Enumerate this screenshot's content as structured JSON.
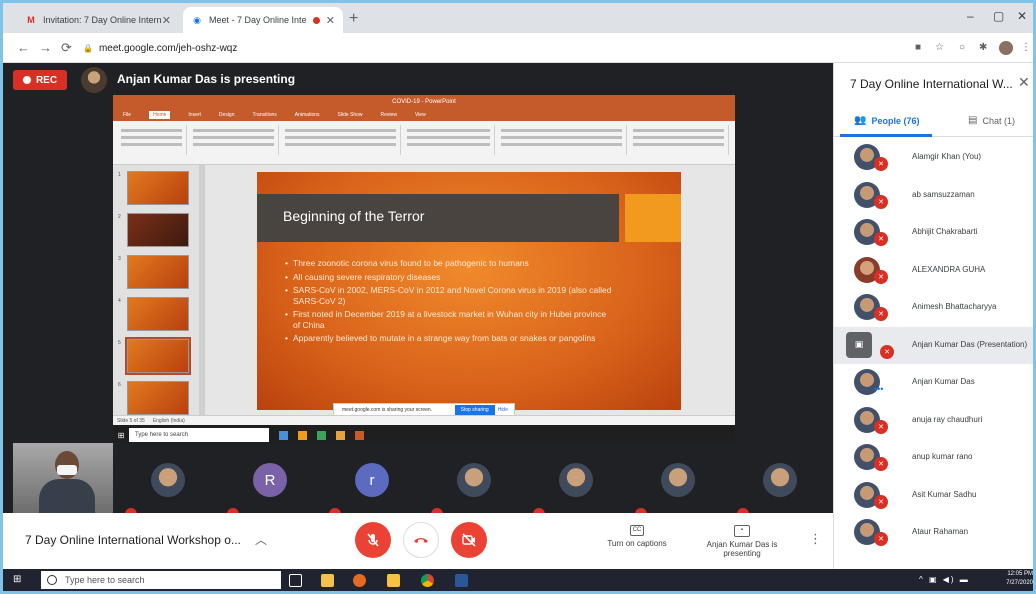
{
  "browser": {
    "tabs": [
      {
        "favicon": "M",
        "title": "Invitation: 7 Day Online Internati",
        "active": false
      },
      {
        "favicon": "◉",
        "title": "Meet - 7 Day Online Internat",
        "active": true
      }
    ],
    "url": "meet.google.com/jeh-oshz-wqz"
  },
  "meet": {
    "rec_label": "REC",
    "presenting_label": "Anjan Kumar Das is presenting",
    "meeting_name": "7 Day Online International Workshop o...",
    "captions_label": "Turn on captions",
    "captions_icon": "CC",
    "presenter_button_label": "Anjan Kumar Das is presenting"
  },
  "shared_screen": {
    "app_title": "COVID-19 - PowerPoint",
    "ribbon_tabs": [
      "File",
      "Home",
      "Insert",
      "Design",
      "Transitions",
      "Animations",
      "Slide Show",
      "Review",
      "View"
    ],
    "slide_title": "Beginning of the Terror",
    "bullets": [
      "Three zoonotic corona virus found to be pathogenic to humans",
      "All causing severe respiratory diseases",
      "SARS-CoV in 2002, MERS-CoV in 2012 and Novel Corona virus in 2019 (also called SARS-CoV 2)",
      "First noted in December 2019 at a livestock market in Wuhan city in Hubei province of China",
      "Apparently believed to mutate in a strange way from bats or snakes or pangolins"
    ],
    "sharing_notice": "meet.google.com is sharing your screen.",
    "stop_sharing": "Stop sharing",
    "hide": "Hide",
    "status_text": "Slide 5 of 35",
    "status_lang": "English (India)",
    "inner_search_placeholder": "Type here to search"
  },
  "participant_tiles": [
    {
      "kind": "photo"
    },
    {
      "kind": "letter",
      "letter": "R",
      "color": "#7b61a8"
    },
    {
      "kind": "letter",
      "letter": "r",
      "color": "#5c6bc0"
    },
    {
      "kind": "photo"
    },
    {
      "kind": "photo"
    },
    {
      "kind": "photo"
    },
    {
      "kind": "photo"
    }
  ],
  "panel": {
    "title": "7 Day Online International W...",
    "people_tab": "People (76)",
    "chat_tab": "Chat (1)",
    "people": [
      {
        "name": "Alamgir Khan (You)",
        "muted": true
      },
      {
        "name": "ab samsuzzaman",
        "muted": true
      },
      {
        "name": "Abhijit Chakrabarti",
        "muted": true
      },
      {
        "name": "ALEXANDRA GUHA",
        "muted": true
      },
      {
        "name": "Animesh Bhattacharyya",
        "muted": true
      },
      {
        "name": "Anjan Kumar Das (Presentation)",
        "muted": true,
        "presentation": true
      },
      {
        "name": "Anjan Kumar Das",
        "muted": false,
        "speaking": true
      },
      {
        "name": "anuja ray chaudhuri",
        "muted": true
      },
      {
        "name": "anup kumar rano",
        "muted": true
      },
      {
        "name": "Asit Kumar Sadhu",
        "muted": true
      },
      {
        "name": "Ataur Rahaman",
        "muted": true
      }
    ]
  },
  "taskbar": {
    "search_placeholder": "Type here to search",
    "time": "12:05 PM",
    "date": "7/27/2020"
  }
}
